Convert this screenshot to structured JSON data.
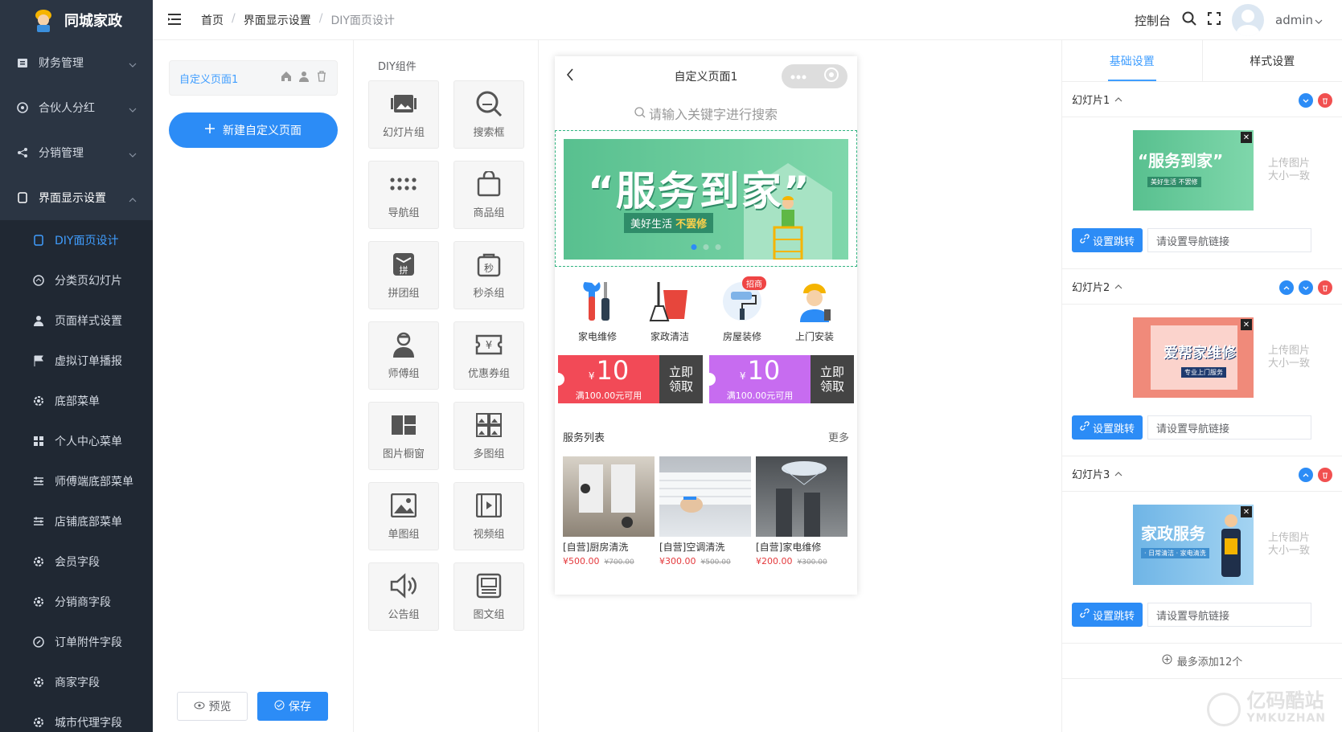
{
  "app": {
    "name": "同城家政"
  },
  "sidebar": {
    "menus": [
      {
        "label": "财务管理",
        "icon": "wallet-icon"
      },
      {
        "label": "合伙人分红",
        "icon": "aperture-icon"
      },
      {
        "label": "分销管理",
        "icon": "share-icon"
      },
      {
        "label": "界面显示设置",
        "icon": "phone-icon"
      }
    ],
    "submenus": [
      {
        "label": "DIY面页设计",
        "icon": "phone-icon"
      },
      {
        "label": "分类页幻灯片",
        "icon": "gauge-icon"
      },
      {
        "label": "页面样式设置",
        "icon": "user-icon"
      },
      {
        "label": "虚拟订单播报",
        "icon": "flag-icon"
      },
      {
        "label": "底部菜单",
        "icon": "cog-icon"
      },
      {
        "label": "个人中心菜单",
        "icon": "grid-icon"
      },
      {
        "label": "师傅端底部菜单",
        "icon": "sliders-icon"
      },
      {
        "label": "店铺底部菜单",
        "icon": "sliders-icon"
      },
      {
        "label": "会员字段",
        "icon": "cog-icon"
      },
      {
        "label": "分销商字段",
        "icon": "cog-icon"
      },
      {
        "label": "订单附件字段",
        "icon": "attach-icon"
      },
      {
        "label": "商家字段",
        "icon": "cog-icon"
      },
      {
        "label": "城市代理字段",
        "icon": "cog-icon"
      }
    ]
  },
  "topbar": {
    "breadcrumb": [
      "首页",
      "界面显示设置",
      "DIY面页设计"
    ],
    "console": "控制台",
    "user": "admin"
  },
  "pages": {
    "current": "自定义页面1",
    "new_label": "新建自定义页面",
    "preview_label": "预览",
    "save_label": "保存"
  },
  "components": {
    "title": "DIY组件",
    "items": [
      {
        "label": "幻灯片组",
        "icon": "slideshow-icon"
      },
      {
        "label": "搜索框",
        "icon": "search-icon"
      },
      {
        "label": "导航组",
        "icon": "dots-grid-icon"
      },
      {
        "label": "商品组",
        "icon": "bag-icon"
      },
      {
        "label": "拼团组",
        "icon": "group-buy-icon"
      },
      {
        "label": "秒杀组",
        "icon": "flash-sale-icon"
      },
      {
        "label": "师傅组",
        "icon": "worker-icon"
      },
      {
        "label": "优惠券组",
        "icon": "coupon-icon"
      },
      {
        "label": "图片橱窗",
        "icon": "image-window-icon"
      },
      {
        "label": "多图组",
        "icon": "multi-image-icon"
      },
      {
        "label": "单图组",
        "icon": "image-icon"
      },
      {
        "label": "视频组",
        "icon": "video-icon"
      },
      {
        "label": "公告组",
        "icon": "speaker-icon"
      },
      {
        "label": "图文组",
        "icon": "article-icon"
      }
    ]
  },
  "phone": {
    "title": "自定义页面1",
    "search_placeholder": "请输入关键字进行搜索",
    "banner": {
      "title": "“服务到家”",
      "sub1": "美好生活",
      "sub2": "不罢修",
      "active_dot": 0,
      "dot_count": 3
    },
    "navs": [
      {
        "label": "家电维修",
        "icon": "tools-icon"
      },
      {
        "label": "家政清洁",
        "icon": "broom-bucket-icon"
      },
      {
        "label": "房屋装修",
        "icon": "paint-roller-icon",
        "tag": "招商"
      },
      {
        "label": "上门安装",
        "icon": "installer-icon"
      }
    ],
    "coupons": [
      {
        "currency": "¥",
        "amount": "10",
        "condition": "满100.00元可用",
        "action_line1": "立即",
        "action_line2": "领取",
        "color": "#f24a57"
      },
      {
        "currency": "¥",
        "amount": "10",
        "condition": "满100.00元可用",
        "action_line1": "立即",
        "action_line2": "领取",
        "color": "#c76cf0"
      }
    ],
    "services_title": "服务列表",
    "services_more": "更多",
    "services": [
      {
        "name": "[自营]厨房清洗",
        "price": "¥500.00",
        "orig": "¥700.00"
      },
      {
        "name": "[自营]空调清洗",
        "price": "¥300.00",
        "orig": "¥500.00"
      },
      {
        "name": "[自营]家电维修",
        "price": "¥200.00",
        "orig": "¥300.00"
      }
    ]
  },
  "settings": {
    "tabs": [
      "基础设置",
      "样式设置"
    ],
    "slides": [
      {
        "title": "幻灯片1",
        "thumb_text": "“服务到家”",
        "thumb_sub": "美好生活 不罢修",
        "hint1": "上传图片",
        "hint2": "大小一致",
        "jump": "设置跳转",
        "link_placeholder": "请设置导航链接"
      },
      {
        "title": "幻灯片2",
        "thumb_text": "爱帮家维修",
        "thumb_sub": "专业上门服务",
        "hint1": "上传图片",
        "hint2": "大小一致",
        "jump": "设置跳转",
        "link_placeholder": "请设置导航链接"
      },
      {
        "title": "幻灯片3",
        "thumb_text": "家政服务",
        "thumb_sub": "· 日常清洁 · 家电清洗",
        "hint1": "上传图片",
        "hint2": "大小一致",
        "jump": "设置跳转",
        "link_placeholder": "请设置导航链接"
      }
    ],
    "more_label": "最多添加12个"
  },
  "watermark": {
    "cn": "亿码酷站",
    "en": "YMKUZHAN"
  }
}
